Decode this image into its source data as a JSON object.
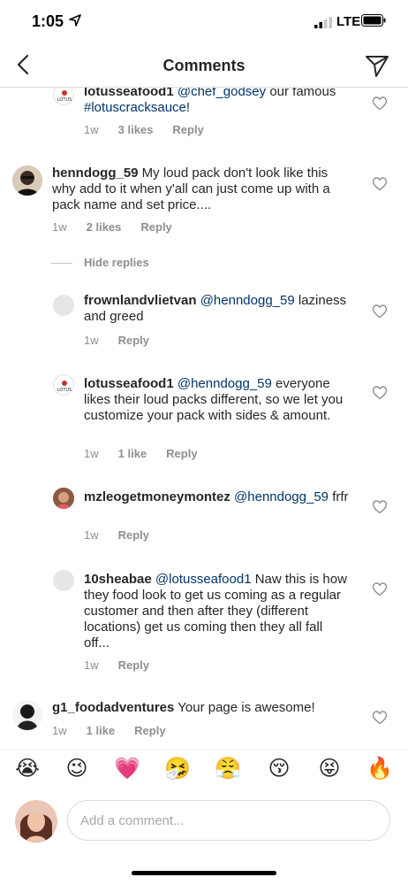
{
  "status": {
    "time": "1:05",
    "network": "LTE"
  },
  "header": {
    "title": "Comments"
  },
  "comments": [
    {
      "user": "lotusseafood1",
      "mention": "@chef_godsey",
      "text": " our famous ",
      "hashtag": "#lotuscracksauce",
      "tail": "!",
      "age": "1w",
      "likes": "3 likes",
      "reply": "Reply"
    },
    {
      "user": "henndogg_59",
      "text": " My loud pack don't look like this why add to it when y'all can just come up with a pack name and set price....",
      "age": "1w",
      "likes": "2 likes",
      "reply": "Reply"
    },
    {
      "user": "frownlandvlietvan",
      "mention": "@henndogg_59",
      "text": " laziness and greed",
      "age": "1w",
      "reply": "Reply"
    },
    {
      "user": "lotusseafood1",
      "mention": "@henndogg_59",
      "text": " everyone likes their loud packs different, so we let you customize your pack with sides & amount.",
      "age": "1w",
      "likes": "1 like",
      "reply": "Reply"
    },
    {
      "user": "mzleogetmoneymontez",
      "mention": "@henndogg_59",
      "text": " frfr",
      "age": "1w",
      "reply": "Reply"
    },
    {
      "user": "10sheabae",
      "mention": "@lotusseafood1",
      "text": " Naw this is how they food look to get us coming as a regular customer and then after they (different locations) get us coming then they all fall off...",
      "age": "1w",
      "reply": "Reply"
    },
    {
      "user": "g1_foodadventures",
      "text": " Your page is awesome!",
      "age": "1w",
      "likes": "1 like",
      "reply": "Reply"
    }
  ],
  "hide_replies": "Hide replies",
  "avatar_logo_text": "LOTUS",
  "emojis": [
    "😭",
    "😉",
    "💗",
    "🤧",
    "😤",
    "😚",
    "😝",
    "🔥"
  ],
  "composer": {
    "placeholder": "Add a comment..."
  },
  "colors": {
    "mention": "#003569",
    "meta": "#8e8e8e",
    "border": "#dbdbdb"
  }
}
